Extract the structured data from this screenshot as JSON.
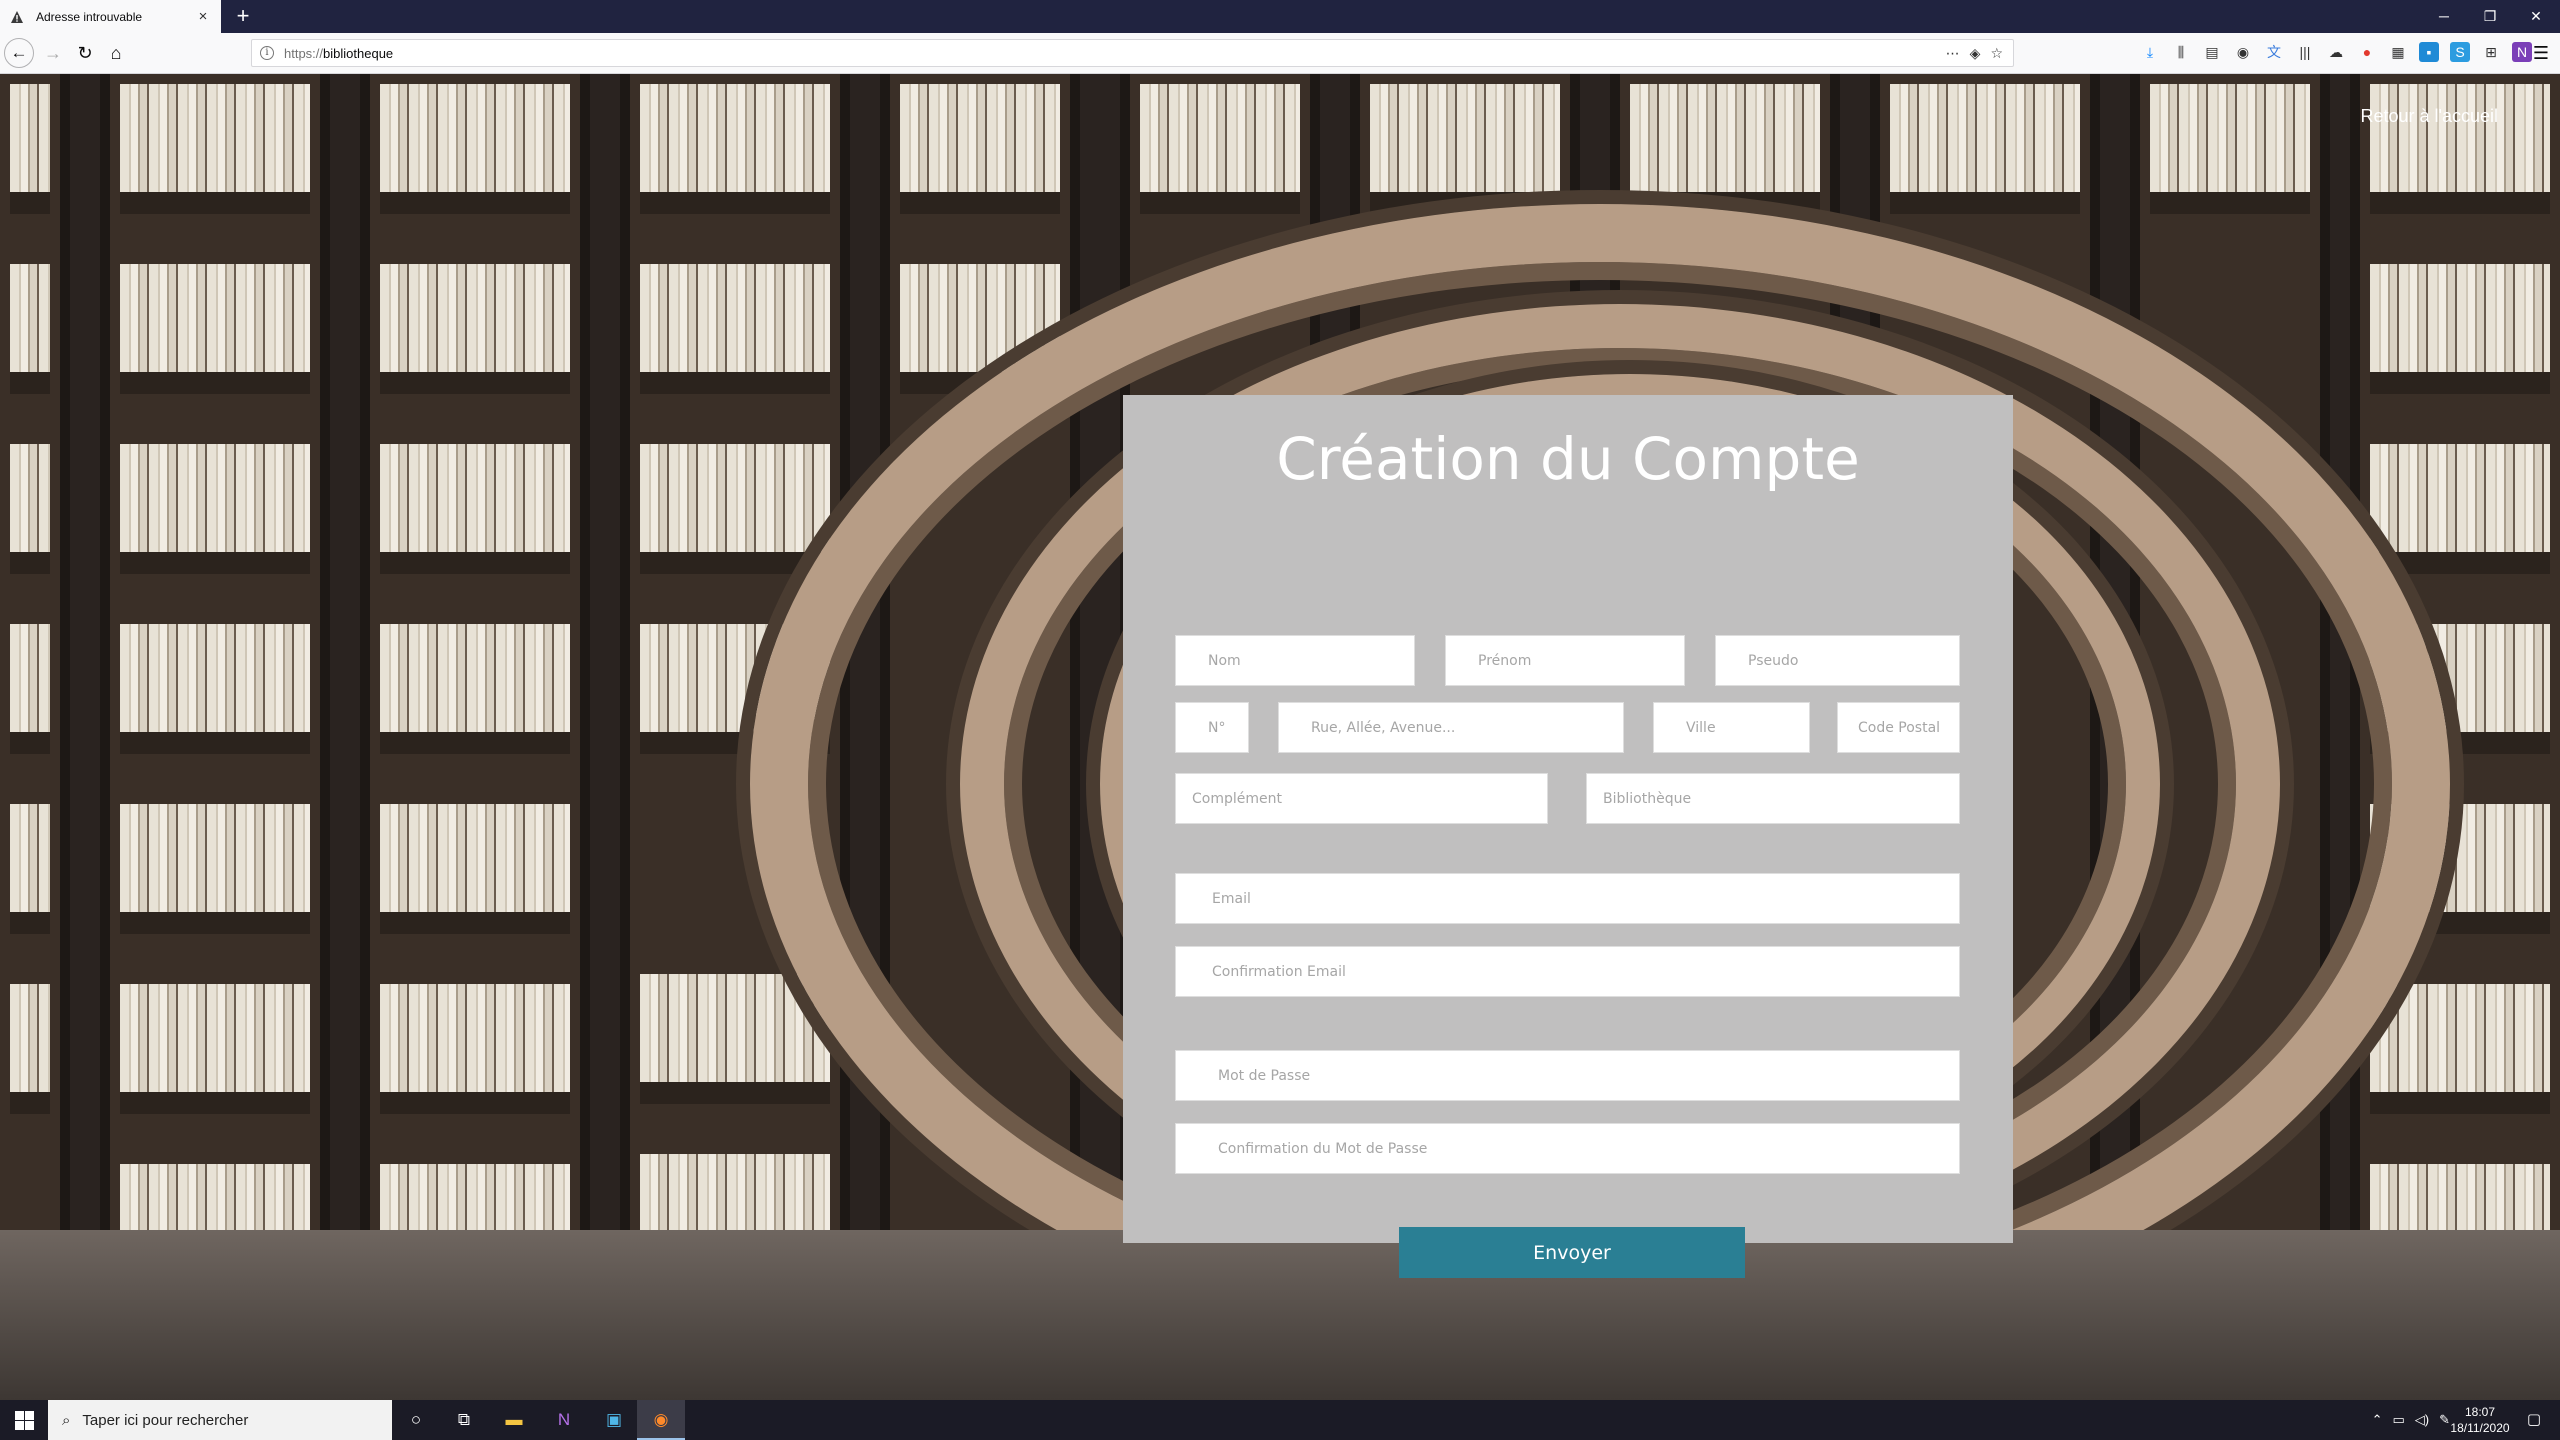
{
  "browser": {
    "tab_title": "Adresse introuvable",
    "tab_close": "×",
    "new_tab": "+",
    "url_scheme": "https://",
    "url_host": "bibliotheque",
    "window_controls": [
      "─",
      "❐",
      "✕"
    ]
  },
  "page": {
    "home_link": "Retour à l'accueil",
    "form": {
      "title": "Création du Compte",
      "fields": {
        "nom": "Nom",
        "prenom": "Prénom",
        "pseudo": "Pseudo",
        "numero": "N°",
        "rue": "Rue, Allée, Avenue...",
        "ville": "Ville",
        "code_postal": "Code Postal",
        "complement": "Complément",
        "bibliotheque": "Bibliothèque",
        "email": "Email",
        "confirmation_email": "Confirmation Email",
        "mot_de_passe": "Mot de Passe",
        "confirmation_mdp": "Confirmation du Mot de Passe"
      },
      "submit_label": "Envoyer"
    }
  },
  "taskbar": {
    "search_placeholder": "Taper ici pour rechercher",
    "time": "18:07",
    "date": "18/11/2020"
  },
  "colors": {
    "card": "#c0bfbf",
    "button": "#2a7f94",
    "tabbar": "#202340"
  }
}
